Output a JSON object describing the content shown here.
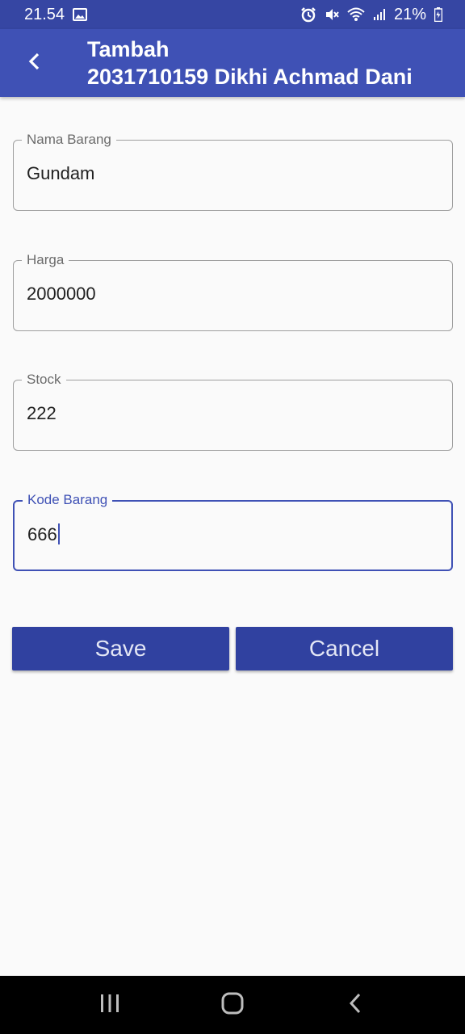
{
  "status_bar": {
    "time": "21.54",
    "battery": "21%",
    "icons": [
      "gallery-icon",
      "alarm-icon",
      "mute-icon",
      "wifi-icon",
      "signal-icon",
      "battery-icon"
    ]
  },
  "app_bar": {
    "title_line1": "Tambah",
    "title_line2": "2031710159 Dikhi Achmad Dani",
    "background": "#3f51b5"
  },
  "form": {
    "nama_barang": {
      "label": "Nama Barang",
      "value": "Gundam"
    },
    "harga": {
      "label": "Harga",
      "value": "2000000"
    },
    "stock": {
      "label": "Stock",
      "value": "222"
    },
    "kode_barang": {
      "label": "Kode Barang",
      "value": "666",
      "focused": true
    }
  },
  "buttons": {
    "save": "Save",
    "cancel": "Cancel",
    "color": "#3041a0"
  },
  "nav_bar": {
    "icons": [
      "recents-icon",
      "home-icon",
      "back-icon"
    ]
  }
}
